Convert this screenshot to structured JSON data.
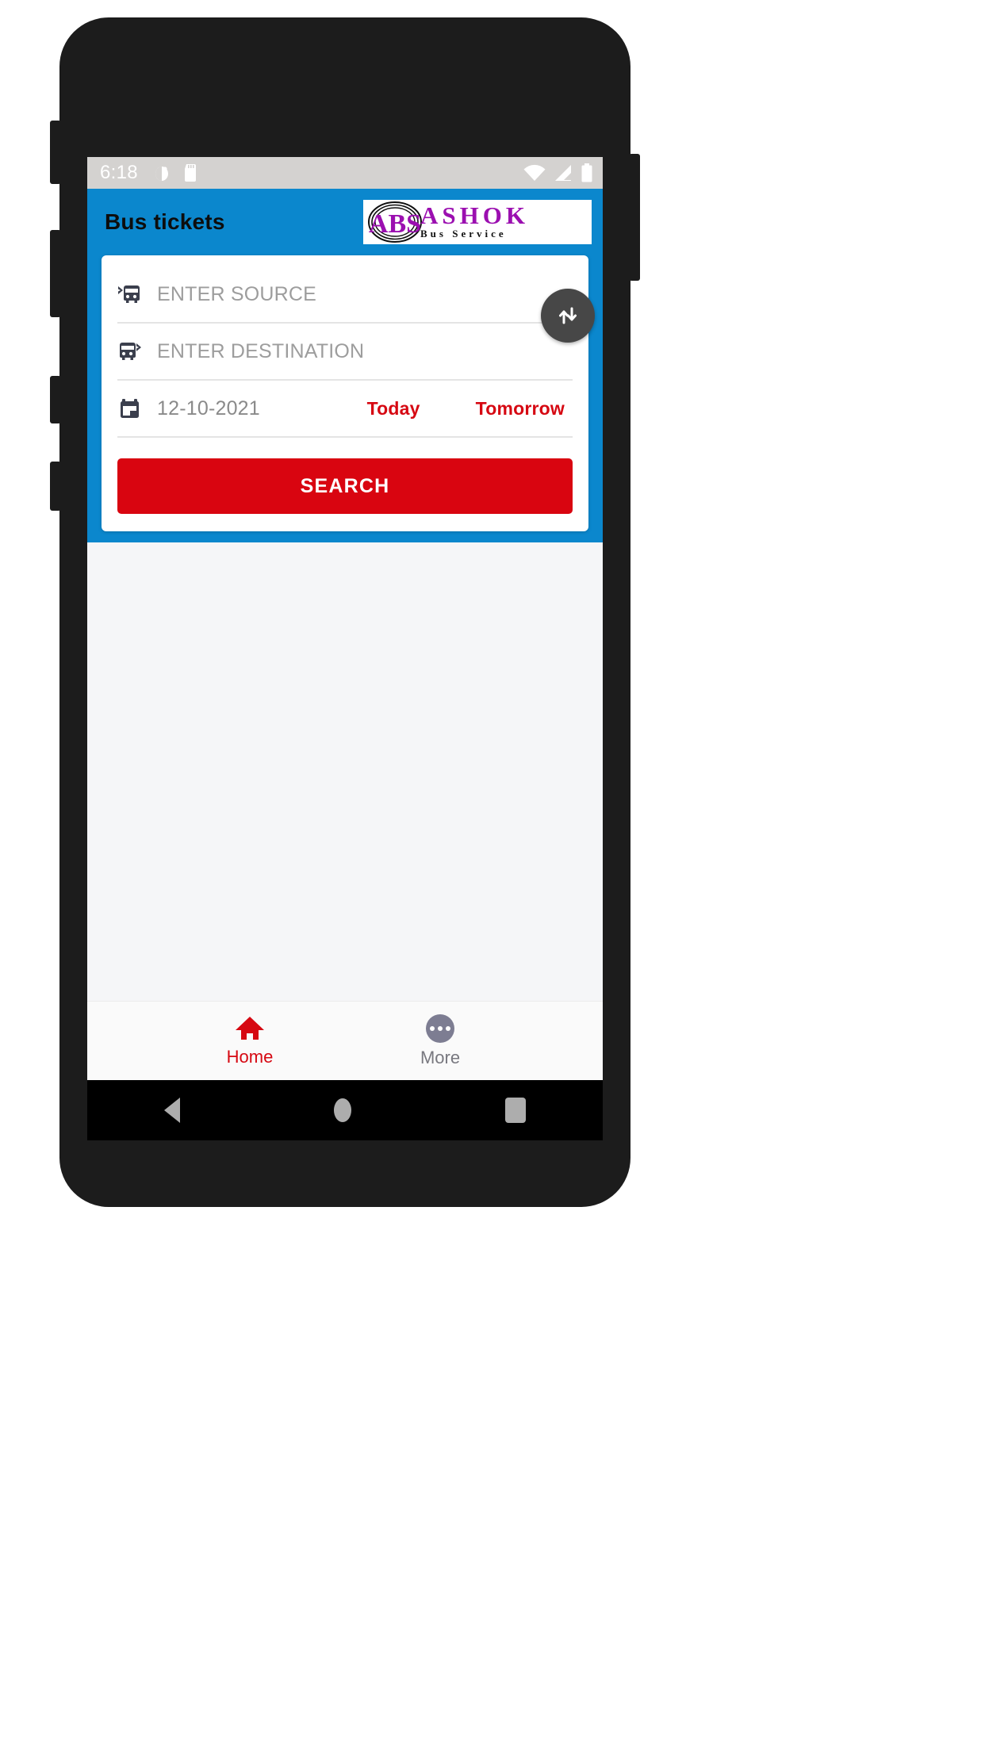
{
  "status_bar": {
    "time": "6:18",
    "left_icons": [
      "do-not-disturb-icon",
      "sd-card-icon"
    ],
    "right_icons": [
      "wifi-icon",
      "cellular-signal-icon",
      "battery-icon"
    ]
  },
  "app_bar": {
    "title": "Bus tickets",
    "logo": {
      "monogram": "ABS",
      "name": "ASHOK",
      "tagline": "Bus Service",
      "name_color": "#9b0fb0",
      "tagline_color": "#111111"
    },
    "background_color": "#0b87cd"
  },
  "search_card": {
    "source": {
      "icon": "bus-departure-icon",
      "placeholder": "ENTER SOURCE",
      "value": ""
    },
    "destination": {
      "icon": "bus-arrival-icon",
      "placeholder": "ENTER DESTINATION",
      "value": ""
    },
    "date": {
      "icon": "calendar-icon",
      "value": "12-10-2021",
      "today_label": "Today",
      "tomorrow_label": "Tomorrow",
      "quick_label_color": "#d60812"
    },
    "swap": {
      "icon": "swap-vertical-icon",
      "background_color": "#474747"
    },
    "search_button": {
      "label": "SEARCH",
      "background_color": "#d90510",
      "text_color": "#ffffff"
    }
  },
  "bottom_nav": {
    "items": [
      {
        "label": "Home",
        "icon": "home-icon",
        "active": true,
        "color": "#d60812"
      },
      {
        "label": "More",
        "icon": "more-dots-icon",
        "active": false,
        "color": "#78787f"
      }
    ]
  },
  "system_nav": {
    "back": "back-triangle-icon",
    "home": "home-circle-icon",
    "recents": "recents-square-icon"
  }
}
